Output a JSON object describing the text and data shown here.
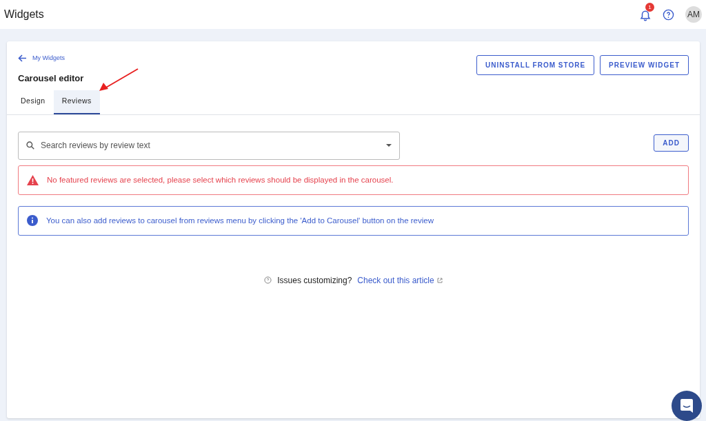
{
  "topbar": {
    "title": "Widgets",
    "notification_count": "1",
    "avatar": "AM"
  },
  "header": {
    "back_link": "My Widgets",
    "title": "Carousel editor",
    "buttons": [
      "UNINSTALL FROM STORE",
      "PREVIEW WIDGET"
    ]
  },
  "tabs": [
    {
      "label": "Design",
      "selected": false
    },
    {
      "label": "Reviews",
      "selected": true
    }
  ],
  "search": {
    "placeholder": "Search reviews by review text"
  },
  "add_button": "ADD",
  "alerts": [
    {
      "kind": "error",
      "text": "No featured reviews are selected, please select which reviews should be displayed in the carousel."
    },
    {
      "kind": "info",
      "text": "You can also add reviews to carousel from reviews menu by clicking the 'Add to Carousel' button on the review"
    }
  ],
  "help": {
    "text": "Issues customizing?",
    "link": "Check out this article"
  }
}
